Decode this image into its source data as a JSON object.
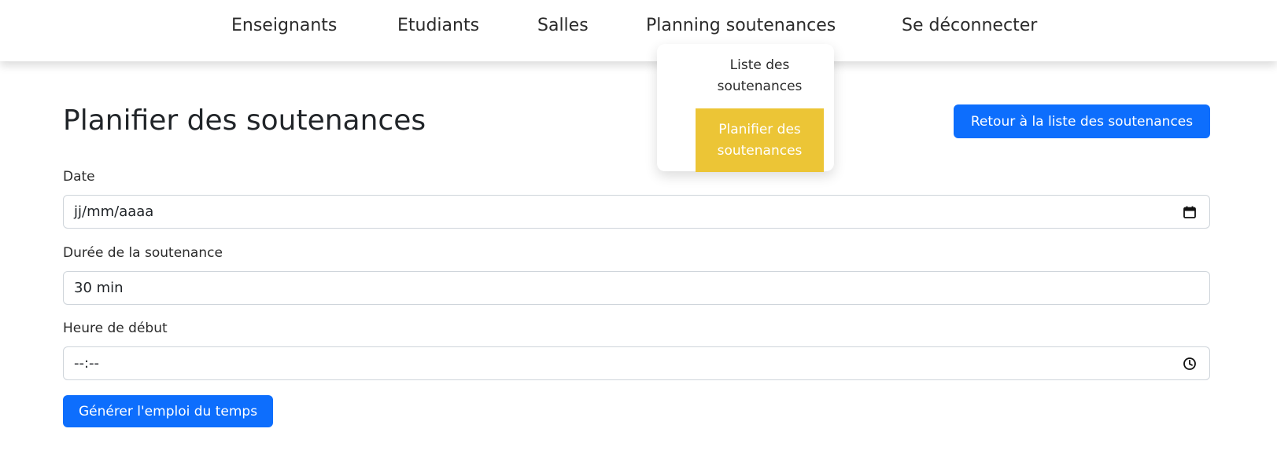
{
  "nav": {
    "items": [
      {
        "label": "Enseignants"
      },
      {
        "label": "Etudiants"
      },
      {
        "label": "Salles"
      },
      {
        "label": "Planning soutenances"
      },
      {
        "label": "Se déconnecter"
      }
    ],
    "dropdown": {
      "items": [
        {
          "label": "Liste des soutenances",
          "active": false
        },
        {
          "label": "Planifier des soutenances",
          "active": true
        }
      ]
    }
  },
  "page": {
    "title": "Planifier des soutenances",
    "back_button_label": "Retour à la liste des soutenances"
  },
  "form": {
    "date": {
      "label": "Date",
      "value": "jj/mm/aaaa",
      "icon": "calendar-icon"
    },
    "duration": {
      "label": "Durée de la soutenance",
      "value": "30 min"
    },
    "start_time": {
      "label": "Heure de début",
      "value": "--:--",
      "icon": "clock-icon"
    },
    "submit_label": "Générer l'emploi du temps"
  },
  "colors": {
    "primary": "#0d6efd",
    "dropdown_active": "#ecc536"
  }
}
